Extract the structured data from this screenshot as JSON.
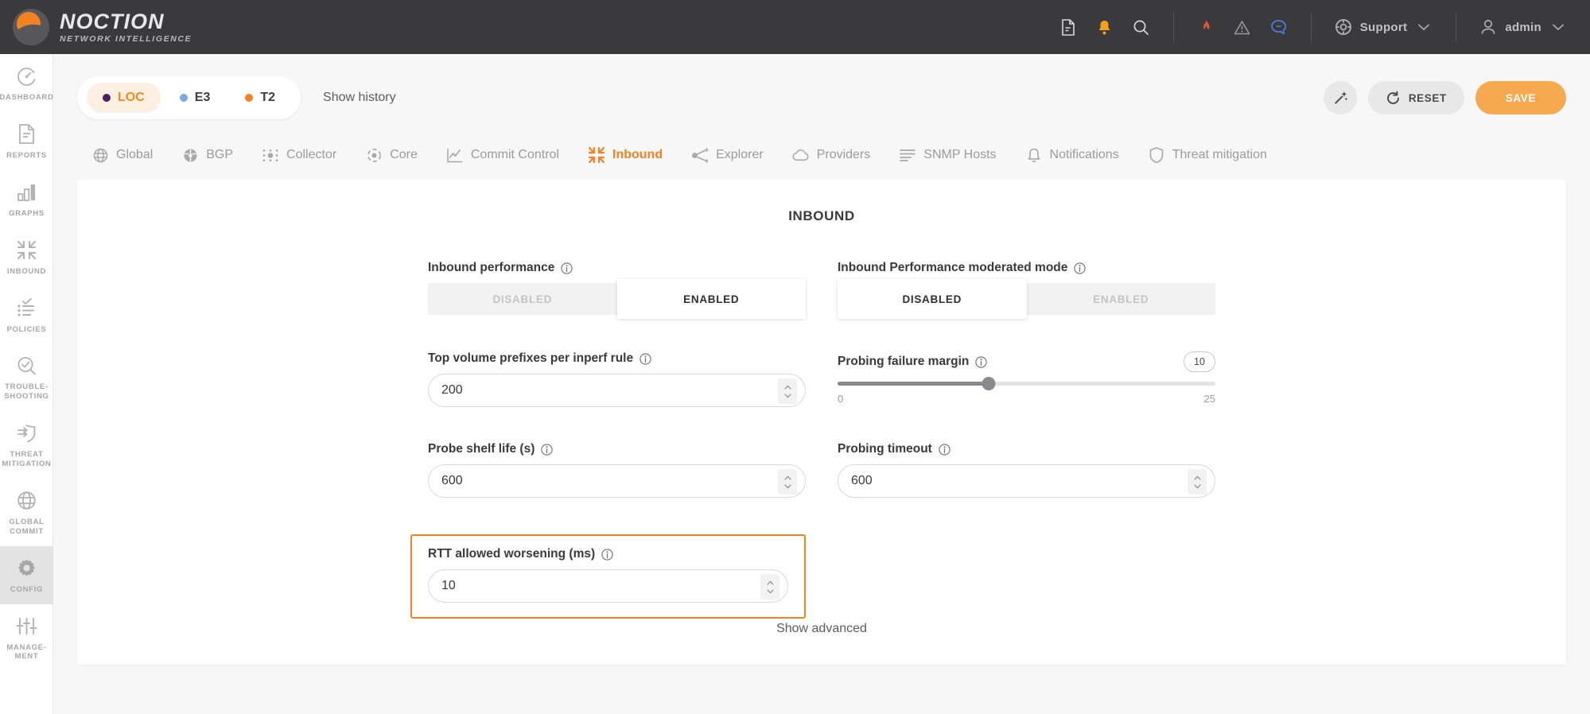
{
  "brand": {
    "name": "NOCTION",
    "tagline": "NETWORK INTELLIGENCE",
    "logo_icon": "noction-logo-icon",
    "accent": "#f58220"
  },
  "topbar": {
    "icons": [
      {
        "name": "document-icon",
        "glyph": "doc"
      },
      {
        "name": "bell-icon",
        "glyph": "bell",
        "color": "#f3a01c"
      },
      {
        "name": "search-icon",
        "glyph": "search"
      }
    ],
    "status_icons": [
      {
        "name": "flame-icon",
        "glyph": "flame",
        "color": "#e2563a"
      },
      {
        "name": "warning-triangle-icon",
        "glyph": "warning",
        "color": "#9a9a9d"
      },
      {
        "name": "chat-bubble-icon",
        "glyph": "chat",
        "color": "#4a7fe0"
      }
    ],
    "support": {
      "label": "Support",
      "icon": "lifebuoy-icon",
      "chevron": "chevron-down-icon"
    },
    "user": {
      "label": "admin",
      "icon": "user-icon",
      "chevron": "chevron-down-icon"
    }
  },
  "sidebar": {
    "items": [
      {
        "label": "DASHBOARD",
        "icon": "gauge-icon",
        "active": false
      },
      {
        "label": "REPORTS",
        "icon": "report-document-icon",
        "active": false
      },
      {
        "label": "GRAPHS",
        "icon": "bar-chart-icon",
        "active": false
      },
      {
        "label": "INBOUND",
        "icon": "inbound-arrows-icon",
        "active": false
      },
      {
        "label": "POLICIES",
        "icon": "checklist-icon",
        "active": false
      },
      {
        "label": "TROUBLE-\nSHOOTING",
        "icon": "magnifier-check-icon",
        "active": false
      },
      {
        "label": "THREAT\nMITIGATION",
        "icon": "shield-arrow-icon",
        "active": false
      },
      {
        "label": "GLOBAL\nCOMMIT",
        "icon": "globe-icon",
        "active": false
      },
      {
        "label": "CONFIG",
        "icon": "gear-icon",
        "active": true
      },
      {
        "label": "MANAGE-\nMENT",
        "icon": "sliders-icon",
        "active": false
      }
    ]
  },
  "subheader": {
    "chips": [
      {
        "label": "LOC",
        "dot_color": "#4b1f5e",
        "active": true
      },
      {
        "label": "E3",
        "dot_color": "#7aa8e0",
        "active": false
      },
      {
        "label": "T2",
        "dot_color": "#f58220",
        "active": false
      }
    ],
    "show_history": "Show history",
    "wand_button": {
      "name": "magic-wand-button",
      "icon": "magic-wand-icon"
    },
    "reset_button": {
      "label": "RESET",
      "icon": "refresh-ccw-icon"
    },
    "save_button": {
      "label": "SAVE"
    }
  },
  "tabs": [
    {
      "label": "Global",
      "icon": "globe-icon",
      "active": false
    },
    {
      "label": "BGP",
      "icon": "bgp-node-icon",
      "active": false
    },
    {
      "label": "Collector",
      "icon": "collector-dots-icon",
      "active": false
    },
    {
      "label": "Core",
      "icon": "core-target-icon",
      "active": false
    },
    {
      "label": "Commit Control",
      "icon": "line-chart-icon",
      "active": false
    },
    {
      "label": "Inbound",
      "icon": "inbound-arrows-icon",
      "active": true
    },
    {
      "label": "Explorer",
      "icon": "share-nodes-icon",
      "active": false
    },
    {
      "label": "Providers",
      "icon": "cloud-icon",
      "active": false
    },
    {
      "label": "SNMP Hosts",
      "icon": "lines-icon",
      "active": false
    },
    {
      "label": "Notifications",
      "icon": "bell-icon",
      "active": false
    },
    {
      "label": "Threat mitigation",
      "icon": "shield-icon",
      "active": false
    }
  ],
  "panel": {
    "title": "INBOUND",
    "show_advanced": "Show advanced",
    "fields": {
      "inbound_performance": {
        "label": "Inbound performance",
        "options": [
          "DISABLED",
          "ENABLED"
        ],
        "selected": "ENABLED"
      },
      "moderated_mode": {
        "label": "Inbound Performance moderated mode",
        "options": [
          "DISABLED",
          "ENABLED"
        ],
        "selected": "DISABLED"
      },
      "top_volume_prefixes": {
        "label": "Top volume prefixes per inperf rule",
        "value": "200"
      },
      "probing_failure_margin": {
        "label": "Probing failure margin",
        "value": "10",
        "min": "0",
        "max": "25",
        "percent": 40
      },
      "probe_shelf_life": {
        "label": "Probe shelf life (s)",
        "value": "600"
      },
      "probing_timeout": {
        "label": "Probing timeout",
        "value": "600"
      },
      "rtt_allowed_worsening": {
        "label": "RTT allowed worsening (ms)",
        "value": "10",
        "highlighted": true
      }
    }
  }
}
